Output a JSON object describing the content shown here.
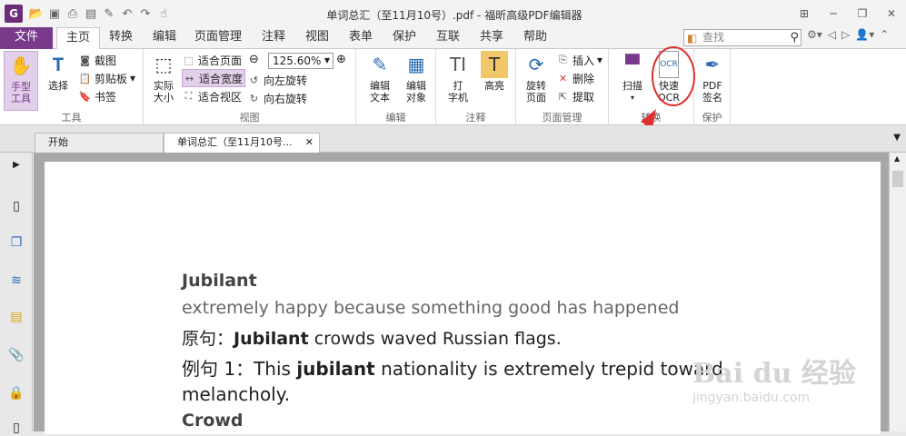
{
  "app": {
    "title": "单词总汇（至11月10号）.pdf - 福昕高级PDF编辑器",
    "icon_letter": "G"
  },
  "quick_access": [
    "open-icon",
    "save-icon",
    "print-icon",
    "scan-icon",
    "new-icon",
    "undo-icon",
    "redo-icon",
    "hand-icon"
  ],
  "ribbon_tabs": [
    {
      "label": "文件"
    },
    {
      "label": "主页"
    },
    {
      "label": "转换"
    },
    {
      "label": "编辑"
    },
    {
      "label": "页面管理"
    },
    {
      "label": "注释"
    },
    {
      "label": "视图"
    },
    {
      "label": "表单"
    },
    {
      "label": "保护"
    },
    {
      "label": "互联"
    },
    {
      "label": "共享"
    },
    {
      "label": "帮助"
    }
  ],
  "search": {
    "placeholder": "查找"
  },
  "groups": {
    "tools": "工具",
    "view": "视图",
    "edit": "编辑",
    "comment": "注释",
    "page_mgmt": "页面管理",
    "convert": "转换",
    "protect": "保护"
  },
  "buttons": {
    "hand": "手型\n工具",
    "select": "选择",
    "snapshot": "截图",
    "clipboard": "剪贴板",
    "bookmark": "书签",
    "actual_size": "实际\n大小",
    "fit_page": "适合页面",
    "fit_width": "适合宽度",
    "fit_visible": "适合视区",
    "rotate_left": "向左旋转",
    "rotate_right": "向右旋转",
    "zoom": "125.60%",
    "edit_text": "编辑\n文本",
    "edit_object": "编辑\n对象",
    "typewriter": "打\n字机",
    "highlight": "高亮",
    "rotate_page": "旋转\n页面",
    "insert": "插入",
    "delete": "删除",
    "extract": "提取",
    "scan": "扫描",
    "quick_ocr": "快速\nOCR",
    "pdf_sign": "PDF\n签名"
  },
  "doc_tabs": [
    {
      "label": "开始"
    },
    {
      "label": "单词总汇（至11月10号..."
    }
  ],
  "document": {
    "lines": [
      {
        "text": "Jubilant",
        "style": "bold"
      },
      {
        "text": "extremely happy because something good has happened",
        "style": "grey"
      },
      {
        "prefix": "原句：",
        "bold": "Jubilant",
        "rest": " crowds waved Russian flags."
      },
      {
        "prefix": "例句 1：This ",
        "bold": "jubilant",
        "rest": " nationality is extremely trepid toward"
      },
      {
        "text": "melancholy."
      },
      {
        "text": "Crowd",
        "style": "bold"
      }
    ]
  },
  "watermark": {
    "brand": "Bai du 经验",
    "url": "jingyan.baidu.com"
  },
  "colors": {
    "accent": "#7a3a8c",
    "annotation": "#e03030"
  }
}
